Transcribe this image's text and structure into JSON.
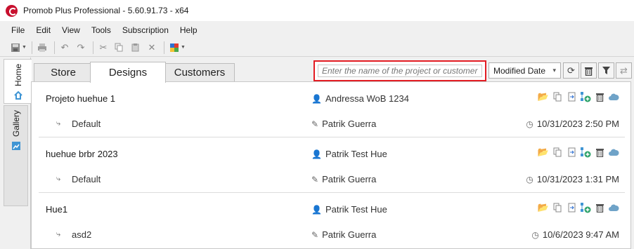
{
  "window": {
    "title": "Promob Plus Professional - 5.60.91.73 - x64"
  },
  "menu": [
    "File",
    "Edit",
    "View",
    "Tools",
    "Subscription",
    "Help"
  ],
  "side_tabs": {
    "home": "Home",
    "gallery": "Gallery"
  },
  "tabs": [
    {
      "label": "Store",
      "active": false
    },
    {
      "label": "Designs",
      "active": true
    },
    {
      "label": "Customers",
      "active": false
    }
  ],
  "search": {
    "placeholder": "Enter the name of the project or customer",
    "value": ""
  },
  "sort": {
    "selected": "Modified Date"
  },
  "projects": [
    {
      "name": "Projeto huehue 1",
      "customer": "Andressa WoB 1234",
      "version": "Default",
      "author": "Patrik Guerra",
      "date": "10/31/2023 2:50 PM"
    },
    {
      "name": "huehue brbr 2023",
      "customer": "Patrik Test Hue",
      "version": "Default",
      "author": "Patrik Guerra",
      "date": "10/31/2023 1:31 PM"
    },
    {
      "name": "Hue1",
      "customer": "Patrik Test Hue",
      "version": "asd2",
      "author": "Patrik Guerra",
      "date": "10/6/2023 9:47 AM"
    }
  ],
  "colors": {
    "highlight": "#e31c23",
    "accent": "#3f95d4",
    "folder": "#e2b66a",
    "add": "#2fa36b"
  }
}
